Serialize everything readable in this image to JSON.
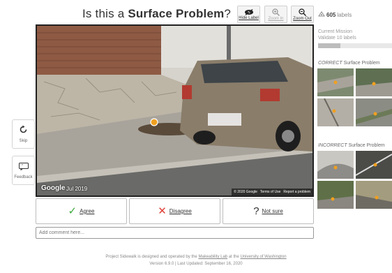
{
  "header": {
    "title_prefix": "Is this a ",
    "title_label_type": "Surface Problem",
    "title_suffix": "?"
  },
  "toolbar": {
    "hide_label": "Hide Label",
    "zoom_in": "Zoom In",
    "zoom_out": "Zoom Out",
    "label_count": "605",
    "label_count_unit": "labels"
  },
  "side_buttons": {
    "skip": "Skip",
    "feedback": "Feedback"
  },
  "panorama": {
    "watermark": "Google",
    "date": "Jul 2019",
    "copyright": "© 2020 Google",
    "terms": "Terms of Use",
    "report": "Report a problem"
  },
  "votes": {
    "agree": "Agree",
    "disagree": "Disagree",
    "not_sure": "Not sure"
  },
  "comment": {
    "placeholder": "Add comment here..."
  },
  "mission": {
    "title": "Current Mission",
    "subtitle": "Validate 10 labels",
    "progress_fraction": 0.3
  },
  "examples": {
    "correct_title_em": "CORRECT",
    "correct_title_rest": " Surface Problem",
    "incorrect_title_em": "INCORRECT",
    "incorrect_title_rest": " Surface Problem"
  },
  "footer": {
    "line1_a": "Project Sidewalk is designed and operated by the ",
    "lab_link": "Makeability Lab",
    "line1_b": " at the ",
    "uni_link": "University of Washington",
    "line2": "Version 6.9.0 | Last Updated: September 16, 2020"
  },
  "colors": {
    "agree": "#3cab3c",
    "disagree": "#e0413a",
    "label_marker": "#f0a020"
  },
  "icons": {
    "hide_label": "eye-slash-icon",
    "zoom_in": "zoom-in-icon",
    "zoom_out": "zoom-out-icon",
    "skip": "skip-icon",
    "feedback": "feedback-icon",
    "agree": "check-icon",
    "disagree": "x-icon",
    "not_sure": "question-icon",
    "label_count": "label-icon"
  }
}
